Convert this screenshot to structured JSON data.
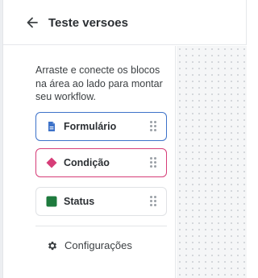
{
  "header": {
    "title": "Teste versoes"
  },
  "sidebar": {
    "description": "Arraste e conecte os blocos na área ao lado para montar seu workflow.",
    "blocks": [
      {
        "label": "Formulário",
        "icon": "document-icon",
        "color": "#3d72c9"
      },
      {
        "label": "Condição",
        "icon": "diamond-icon",
        "color": "#d63d78"
      },
      {
        "label": "Status",
        "icon": "square-icon",
        "color": "#1e7a3d"
      }
    ],
    "settings_label": "Configurações"
  },
  "colors": {
    "accent_blue": "#3d72c9",
    "accent_pink": "#d63d78",
    "status_green": "#1e7a3d"
  }
}
